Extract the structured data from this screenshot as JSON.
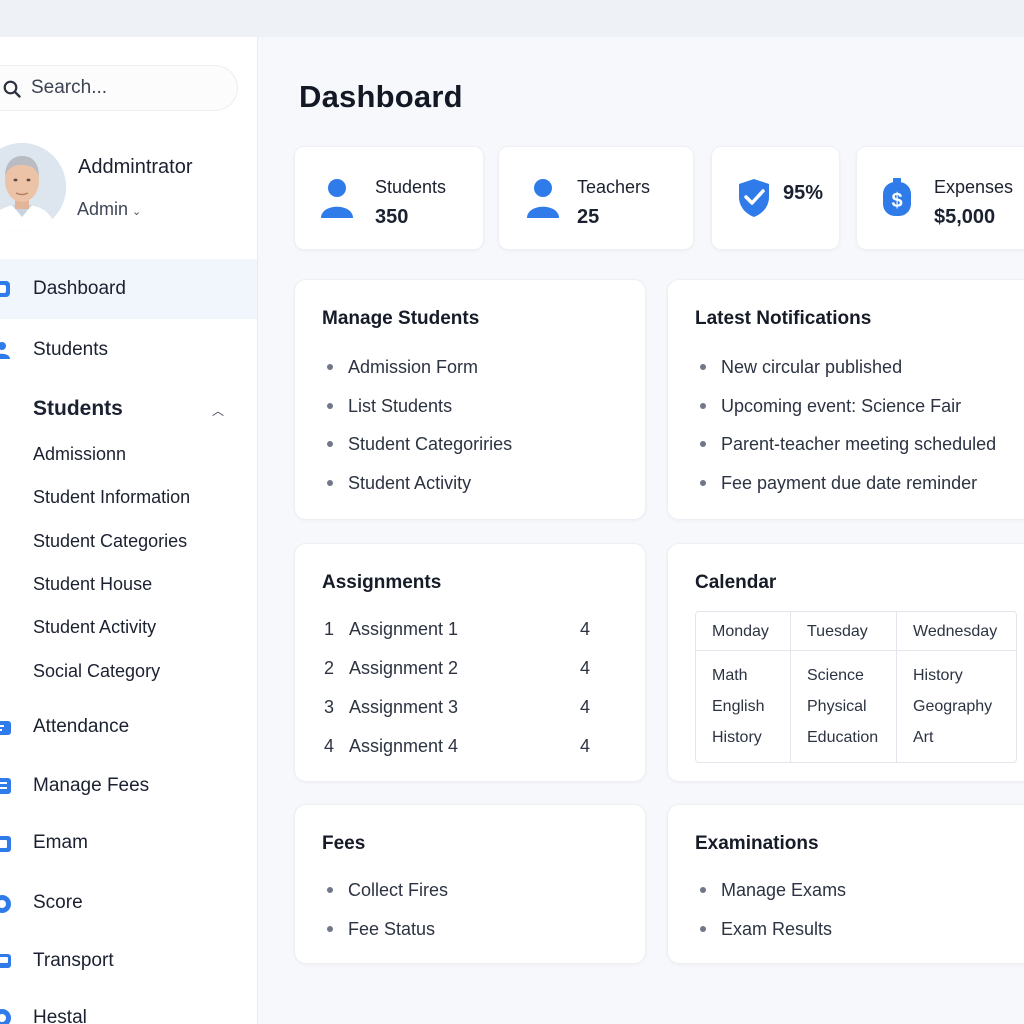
{
  "search": {
    "placeholder": "Search..."
  },
  "profile": {
    "name": "Addmintrator",
    "role": "Admin"
  },
  "nav": {
    "dashboard": "Dashboard",
    "students": "Students",
    "students_section": "Students",
    "sub_items": [
      "Admissionn",
      "Student Information",
      "Student Categories",
      "Student House",
      "Student Activity",
      "Social Category"
    ],
    "attendance": "Attendance",
    "manage_fees": "Manage Fees",
    "emam": "Emam",
    "score": "Score",
    "transport": "Transport",
    "hestal": "Hestal"
  },
  "page": {
    "title": "Dashboard"
  },
  "stats": [
    {
      "label": "Students",
      "value": "350"
    },
    {
      "label": "Teachers",
      "value": "25"
    },
    {
      "value": "95%"
    },
    {
      "label": "Expenses",
      "value": "$5,000"
    }
  ],
  "manage_students": {
    "title": "Manage Students",
    "items": [
      "Admission Form",
      "List Students",
      "Student Categoriries",
      "Student Activity"
    ]
  },
  "notifications": {
    "title": "Latest Notifications",
    "items": [
      "New circular published",
      "Upcoming event: Science Fair",
      "Parent-teacher meeting scheduled",
      "Fee payment due date reminder"
    ]
  },
  "assignments": {
    "title": "Assignments",
    "rows": [
      {
        "num": "1",
        "name": "Assignment 1",
        "count": "4"
      },
      {
        "num": "2",
        "name": "Assignment 2",
        "count": "4"
      },
      {
        "num": "3",
        "name": "Assignment 3",
        "count": "4"
      },
      {
        "num": "4",
        "name": "Assignment 4",
        "count": "4"
      }
    ]
  },
  "calendar": {
    "title": "Calendar",
    "days": [
      {
        "name": "Monday",
        "items": [
          "Math",
          "English",
          "History"
        ]
      },
      {
        "name": "Tuesday",
        "items": [
          "Science",
          "Physical",
          "Education"
        ]
      },
      {
        "name": "Wednesday",
        "items": [
          "History",
          "Geography",
          "Art"
        ]
      }
    ]
  },
  "fees": {
    "title": "Fees",
    "items": [
      "Collect Fires",
      "Fee Status"
    ]
  },
  "examinations": {
    "title": "Examinations",
    "items": [
      "Manage Exams",
      "Exam Results"
    ]
  },
  "colors": {
    "accent": "#2f7bea",
    "active_bg": "#f1f5fc",
    "text": "#1b2130"
  }
}
